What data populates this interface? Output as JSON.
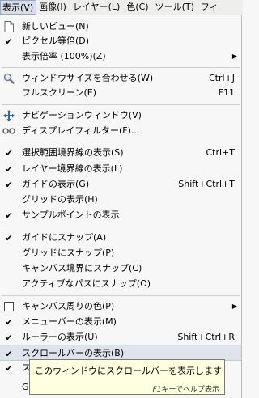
{
  "menubar": [
    {
      "label": "表示(V)",
      "active": true
    },
    {
      "label": "画像(I)"
    },
    {
      "label": "レイヤー(L)"
    },
    {
      "label": "色(C)"
    },
    {
      "label": "ツール(T)"
    },
    {
      "label": "フィ"
    }
  ],
  "menu": {
    "items": [
      {
        "label": "新しいビュー(N)",
        "icon": "new-view-icon"
      },
      {
        "label": "ピクセル等倍(D)",
        "check": true
      },
      {
        "label": "表示倍率 (100%)(Z)",
        "submenu": true
      },
      {
        "label": "ウィンドウサイズを合わせる(W)",
        "shortcut": "Ctrl+J",
        "icon": "zoom-icon"
      },
      {
        "label": "フルスクリーン(E)",
        "shortcut": "F11"
      },
      {
        "label": "ナビゲーションウィンドウ(V)",
        "icon": "navigation-icon"
      },
      {
        "label": "ディスプレイフィルター(F)...",
        "icon": "display-filter-icon"
      },
      {
        "label": "選択範囲境界線の表示(S)",
        "shortcut": "Ctrl+T",
        "check": true
      },
      {
        "label": "レイヤー境界線の表示(L)",
        "check": true
      },
      {
        "label": "ガイドの表示(G)",
        "shortcut": "Shift+Ctrl+T",
        "check": true
      },
      {
        "label": "グリッドの表示(H)"
      },
      {
        "label": "サンプルポイントの表示",
        "check": true
      },
      {
        "label": "ガイドにスナップ(A)",
        "check": true
      },
      {
        "label": "グリッドにスナップ(P)"
      },
      {
        "label": "キャンバス境界にスナップ(C)"
      },
      {
        "label": "アクティブなパスにスナップ(O)"
      },
      {
        "label": "キャンバス周りの色(P)",
        "submenu": true,
        "icon": "color-swatch-icon"
      },
      {
        "label": "メニューバーの表示(M)",
        "check": true
      },
      {
        "label": "ルーラーの表示(U)",
        "shortcut": "Shift+Ctrl+R",
        "check": true
      },
      {
        "label": "スクロールバーの表示(B)",
        "check": true,
        "highlight": true
      },
      {
        "label": "ス",
        "check": true
      },
      {
        "label": "GE"
      }
    ]
  },
  "tooltip": {
    "text": "このウィンドウにスクロールバーを表示します",
    "help_key": "F1",
    "help_text": "キーでヘルプ表示"
  }
}
